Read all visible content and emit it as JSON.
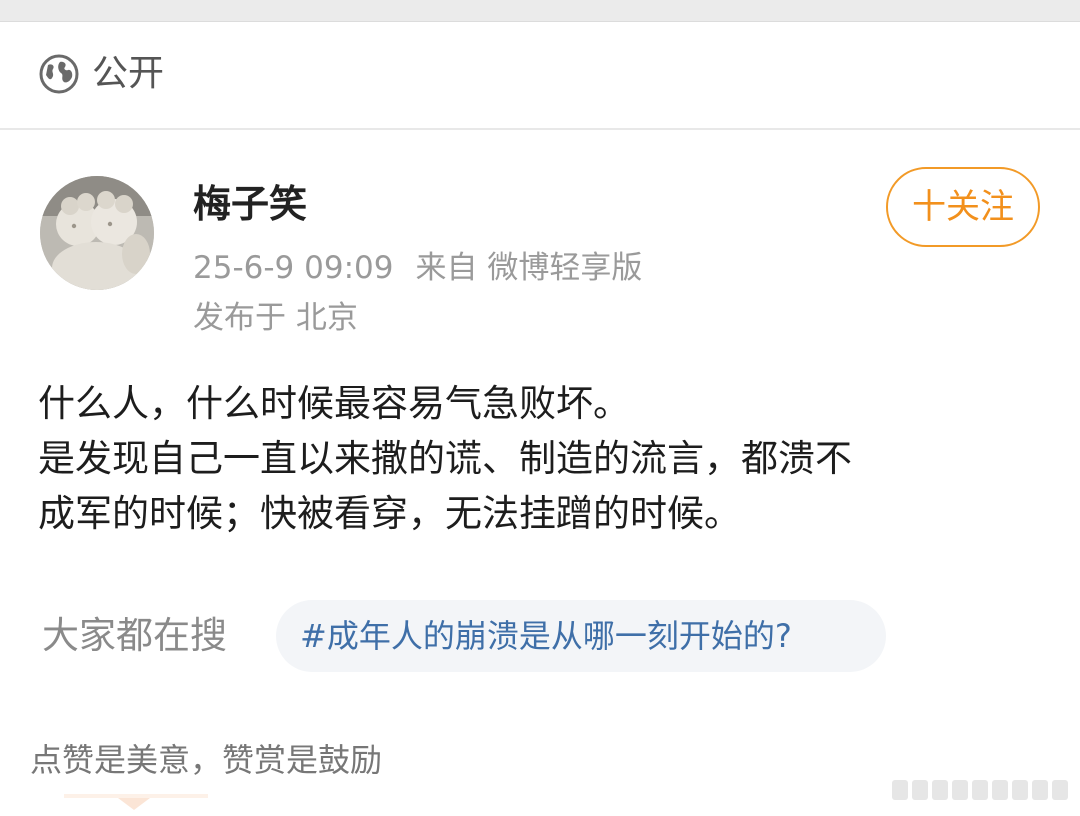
{
  "visibility": {
    "icon": "globe-icon",
    "label": "公开"
  },
  "post": {
    "author": "梅子笑",
    "time": "25-6-9 09:09",
    "source": "来自 微博轻享版",
    "location": "发布于 北京",
    "follow_label": "十关注",
    "text_lines": [
      "什么人，什么时候最容易气急败坏。",
      "是发现自己一直以来撒的谎、制造的流言，都溃不",
      "成军的时候；快被看穿，无法挂蹭的时候。"
    ]
  },
  "search": {
    "label": "大家都在搜",
    "topic": "#成年人的崩溃是从哪一刻开始的?"
  },
  "reward": {
    "text": "点赞是美意，赞赏是鼓励"
  },
  "colors": {
    "accent_orange": "#f29a27",
    "topic_blue": "#3f6fa8",
    "pill_bg": "#f3f5f8"
  }
}
